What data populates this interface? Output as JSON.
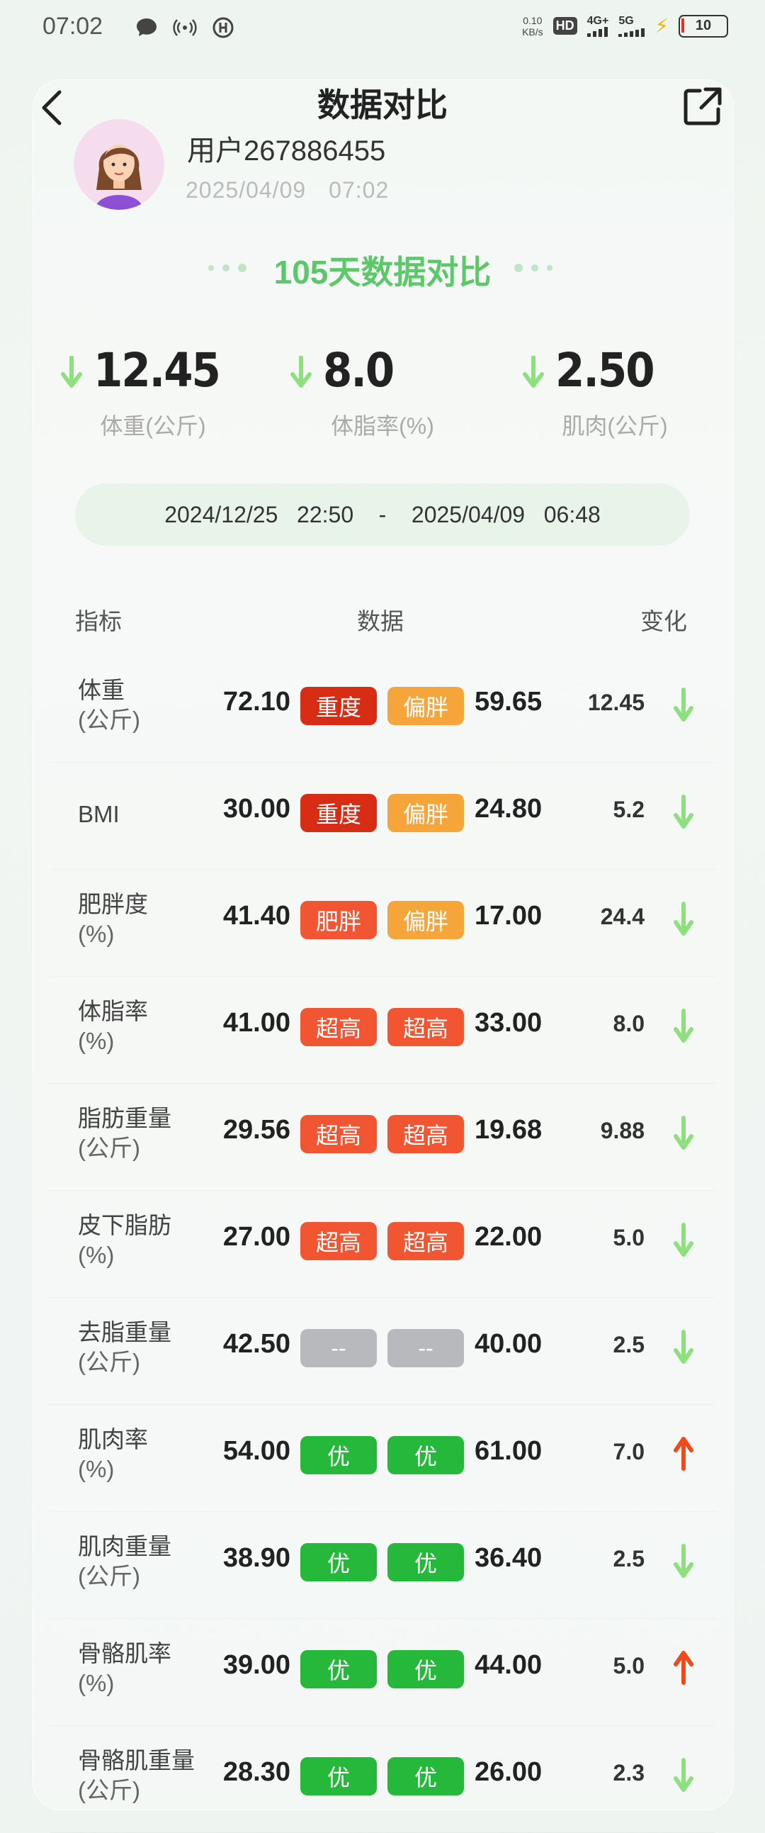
{
  "status_bar": {
    "time": "07:02",
    "net_speed_value": "0.10",
    "net_speed_unit": "KB/s",
    "hd_label": "HD",
    "sim1_label": "4G+",
    "sim2_label": "5G",
    "battery": "10"
  },
  "header": {
    "title": "数据对比"
  },
  "user": {
    "name": "用户267886455",
    "date": "2025/04/09",
    "time": "07:02"
  },
  "summary": {
    "title": "105天数据对比",
    "items": [
      {
        "value": "12.45",
        "label": "体重(公斤)",
        "direction": "down"
      },
      {
        "value": "8.0",
        "label": "体脂率(%)",
        "direction": "down"
      },
      {
        "value": "2.50",
        "label": "肌肉(公斤)",
        "direction": "down"
      }
    ]
  },
  "range": {
    "start_date": "2024/12/25",
    "start_time": "22:50",
    "separator": "-",
    "end_date": "2025/04/09",
    "end_time": "06:48"
  },
  "table": {
    "headers": [
      "指标",
      "数据",
      "变化"
    ],
    "rows": [
      {
        "name": "体重",
        "unit": "(公斤)",
        "before": "72.10",
        "tag1": "重度",
        "tag2": "偏胖",
        "after": "59.65",
        "change": "12.45",
        "direction": "down"
      },
      {
        "name": "BMI",
        "unit": "",
        "before": "30.00",
        "tag1": "重度",
        "tag2": "偏胖",
        "after": "24.80",
        "change": "5.2",
        "direction": "down"
      },
      {
        "name": "肥胖度",
        "unit": "(%)",
        "before": "41.40",
        "tag1": "肥胖",
        "tag2": "偏胖",
        "after": "17.00",
        "change": "24.4",
        "direction": "down"
      },
      {
        "name": "体脂率",
        "unit": "(%)",
        "before": "41.00",
        "tag1": "超高",
        "tag2": "超高",
        "after": "33.00",
        "change": "8.0",
        "direction": "down"
      },
      {
        "name": "脂肪重量",
        "unit": "(公斤)",
        "before": "29.56",
        "tag1": "超高",
        "tag2": "超高",
        "after": "19.68",
        "change": "9.88",
        "direction": "down"
      },
      {
        "name": "皮下脂肪",
        "unit": "(%)",
        "before": "27.00",
        "tag1": "超高",
        "tag2": "超高",
        "after": "22.00",
        "change": "5.0",
        "direction": "down"
      },
      {
        "name": "去脂重量",
        "unit": "(公斤)",
        "before": "42.50",
        "tag1": "--",
        "tag2": "--",
        "after": "40.00",
        "change": "2.5",
        "direction": "down"
      },
      {
        "name": "肌肉率",
        "unit": "(%)",
        "before": "54.00",
        "tag1": "优",
        "tag2": "优",
        "after": "61.00",
        "change": "7.0",
        "direction": "up"
      },
      {
        "name": "肌肉重量",
        "unit": "(公斤)",
        "before": "38.90",
        "tag1": "优",
        "tag2": "优",
        "after": "36.40",
        "change": "2.5",
        "direction": "down"
      },
      {
        "name": "骨骼肌率",
        "unit": "(%)",
        "before": "39.00",
        "tag1": "优",
        "tag2": "优",
        "after": "44.00",
        "change": "5.0",
        "direction": "up"
      },
      {
        "name": "骨骼肌重量",
        "unit": "(公斤)",
        "before": "28.30",
        "tag1": "优",
        "tag2": "优",
        "after": "26.00",
        "change": "2.3",
        "direction": "down"
      }
    ]
  },
  "colors": {
    "tag_severe": "#d62d14",
    "tag_overweight": "#f5a53a",
    "tag_high": "#f25531",
    "tag_obese": "#f25531",
    "tag_good": "#25b83a",
    "tag_none": "#b7b9bd",
    "arrow_down": "#8ee07f",
    "arrow_up": "#ef4a1e",
    "accent_green": "#5cc86a"
  }
}
